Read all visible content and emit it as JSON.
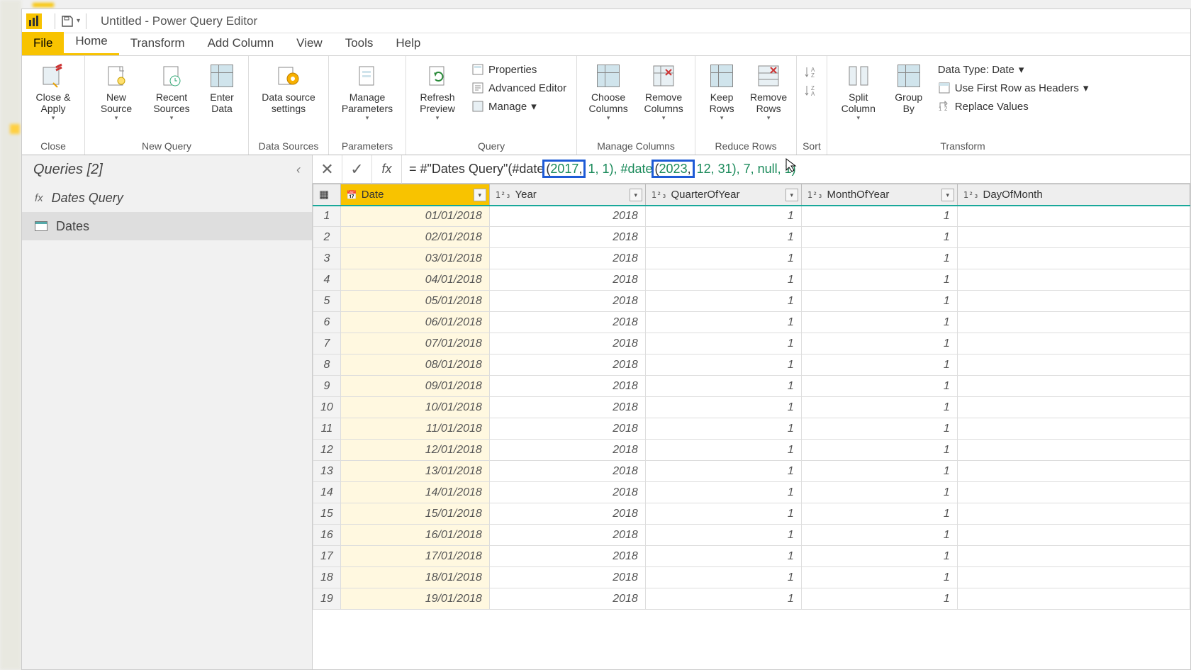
{
  "window": {
    "title": "Untitled - Power Query Editor"
  },
  "menu": {
    "file": "File",
    "tabs": [
      "Home",
      "Transform",
      "Add Column",
      "View",
      "Tools",
      "Help"
    ],
    "active": "Home"
  },
  "ribbon": {
    "close": {
      "closeApply": "Close &\nApply",
      "group": "Close"
    },
    "newQuery": {
      "newSource": "New\nSource",
      "recentSources": "Recent\nSources",
      "enterData": "Enter\nData",
      "group": "New Query"
    },
    "dataSources": {
      "settings": "Data source\nsettings",
      "group": "Data Sources"
    },
    "parameters": {
      "manage": "Manage\nParameters",
      "group": "Parameters"
    },
    "query": {
      "refresh": "Refresh\nPreview",
      "properties": "Properties",
      "advanced": "Advanced Editor",
      "manage": "Manage",
      "group": "Query"
    },
    "manageCols": {
      "choose": "Choose\nColumns",
      "remove": "Remove\nColumns",
      "group": "Manage Columns"
    },
    "reduceRows": {
      "keep": "Keep\nRows",
      "remove": "Remove\nRows",
      "group": "Reduce Rows"
    },
    "sort": {
      "group": "Sort"
    },
    "transform": {
      "split": "Split\nColumn",
      "groupBy": "Group\nBy",
      "dataType": "Data Type: Date",
      "firstRow": "Use First Row as Headers",
      "replace": "Replace Values",
      "group": "Transform"
    }
  },
  "queries": {
    "header": "Queries [2]",
    "items": [
      {
        "name": "Dates Query",
        "type": "fx"
      },
      {
        "name": "Dates",
        "type": "table",
        "selected": true
      }
    ]
  },
  "formula": {
    "pre": "= #\"Dates Query\"(#date",
    "hl1_open": "(",
    "hl1_num": "2017",
    "hl1_after": ",",
    "mid1": " 1, 1), #date",
    "hl2_open": "(",
    "hl2_num": "2023",
    "hl2_after": ",",
    "mid2": " 12, 31), 7, null, 1)"
  },
  "columns": [
    {
      "name": "Date",
      "type": "date",
      "selected": true
    },
    {
      "name": "Year",
      "type": "int"
    },
    {
      "name": "QuarterOfYear",
      "type": "int"
    },
    {
      "name": "MonthOfYear",
      "type": "int"
    },
    {
      "name": "DayOfMonth",
      "type": "int"
    }
  ],
  "rows": [
    {
      "n": 1,
      "date": "01/01/2018",
      "year": "2018",
      "q": "1",
      "m": "1"
    },
    {
      "n": 2,
      "date": "02/01/2018",
      "year": "2018",
      "q": "1",
      "m": "1"
    },
    {
      "n": 3,
      "date": "03/01/2018",
      "year": "2018",
      "q": "1",
      "m": "1"
    },
    {
      "n": 4,
      "date": "04/01/2018",
      "year": "2018",
      "q": "1",
      "m": "1"
    },
    {
      "n": 5,
      "date": "05/01/2018",
      "year": "2018",
      "q": "1",
      "m": "1"
    },
    {
      "n": 6,
      "date": "06/01/2018",
      "year": "2018",
      "q": "1",
      "m": "1"
    },
    {
      "n": 7,
      "date": "07/01/2018",
      "year": "2018",
      "q": "1",
      "m": "1"
    },
    {
      "n": 8,
      "date": "08/01/2018",
      "year": "2018",
      "q": "1",
      "m": "1"
    },
    {
      "n": 9,
      "date": "09/01/2018",
      "year": "2018",
      "q": "1",
      "m": "1"
    },
    {
      "n": 10,
      "date": "10/01/2018",
      "year": "2018",
      "q": "1",
      "m": "1"
    },
    {
      "n": 11,
      "date": "11/01/2018",
      "year": "2018",
      "q": "1",
      "m": "1"
    },
    {
      "n": 12,
      "date": "12/01/2018",
      "year": "2018",
      "q": "1",
      "m": "1"
    },
    {
      "n": 13,
      "date": "13/01/2018",
      "year": "2018",
      "q": "1",
      "m": "1"
    },
    {
      "n": 14,
      "date": "14/01/2018",
      "year": "2018",
      "q": "1",
      "m": "1"
    },
    {
      "n": 15,
      "date": "15/01/2018",
      "year": "2018",
      "q": "1",
      "m": "1"
    },
    {
      "n": 16,
      "date": "16/01/2018",
      "year": "2018",
      "q": "1",
      "m": "1"
    },
    {
      "n": 17,
      "date": "17/01/2018",
      "year": "2018",
      "q": "1",
      "m": "1"
    },
    {
      "n": 18,
      "date": "18/01/2018",
      "year": "2018",
      "q": "1",
      "m": "1"
    },
    {
      "n": 19,
      "date": "19/01/2018",
      "year": "2018",
      "q": "1",
      "m": "1"
    }
  ]
}
